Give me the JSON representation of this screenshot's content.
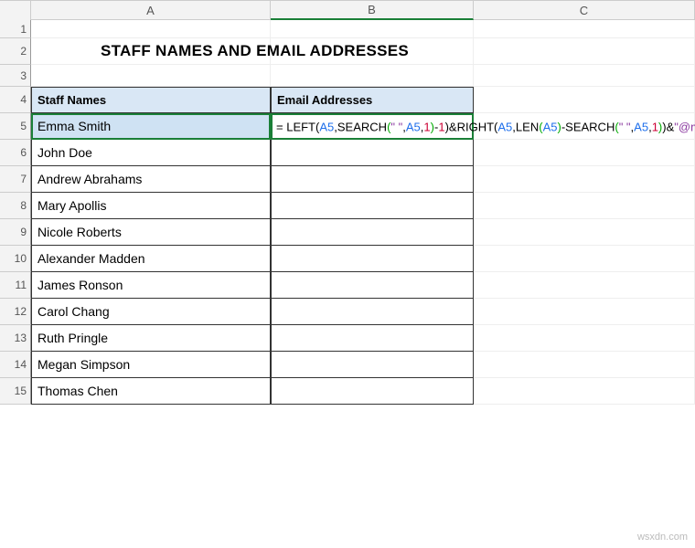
{
  "columns": {
    "A": "A",
    "B": "B",
    "C": "C"
  },
  "rownums": {
    "r1": "1",
    "r2": "2",
    "r3": "3",
    "r4": "4",
    "r5": "5",
    "r6": "6",
    "r7": "7",
    "r8": "8",
    "r9": "9",
    "r10": "10",
    "r11": "11",
    "r12": "12",
    "r13": "13",
    "r14": "14",
    "r15": "15"
  },
  "title": "STAFF NAMES AND EMAIL ADDRESSES",
  "headers": {
    "names": "Staff Names",
    "emails": "Email Addresses"
  },
  "staff": {
    "r5": "Emma Smith",
    "r6": "John Doe",
    "r7": "Andrew Abrahams",
    "r8": "Mary Apollis",
    "r9": "Nicole Roberts",
    "r10": "Alexander Madden",
    "r11": "James Ronson",
    "r12": "Carol Chang",
    "r13": "Ruth Pringle",
    "r14": "Megan Simpson",
    "r15": "Thomas Chen"
  },
  "formula": {
    "eq": "= ",
    "fn_left": "LEFT",
    "p1o": "(",
    "ref1": "A5",
    "c1": ",",
    "fn_search1": "SEARCH",
    "p2o": "(",
    "str_space1": "\" \"",
    "c2": ",",
    "ref2": "A5",
    "c3": ",",
    "num1": "1",
    "p2c": ")",
    "minus1": "-",
    "num2": "1",
    "p1c": ")",
    "amp1": "&",
    "fn_right": "RIGHT",
    "p3o": "(",
    "ref3": "A5",
    "c4": ",",
    "fn_len": "LEN",
    "p4o": "(",
    "ref4": "A5",
    "p4c": ")",
    "minus2": "-",
    "fn_search2": "SEARCH",
    "p5o": "(",
    "str_space2": "\" \"",
    "c5": ",",
    "ref5": "A5",
    "c6": ",",
    "num3": "1",
    "p5c": ")",
    "p3c": ")",
    "amp2": "&",
    "str_domain": "\"@mycompany.com\"",
    "cursor": "|"
  },
  "watermark": "wsxdn.com"
}
